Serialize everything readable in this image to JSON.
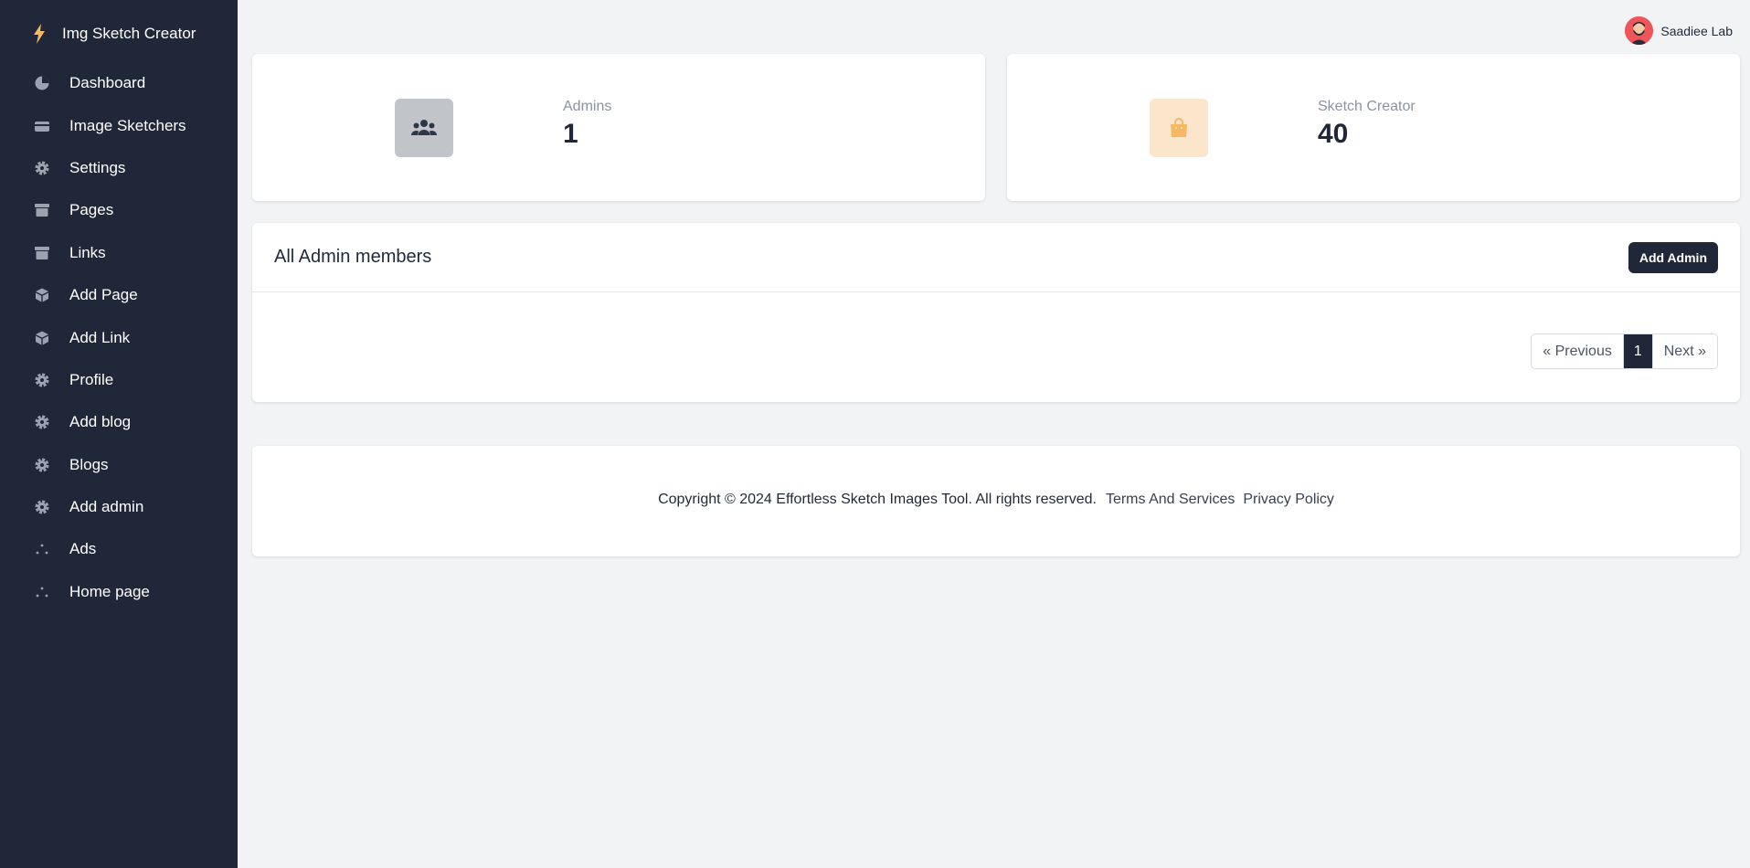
{
  "sidebar": {
    "brand": "Img Sketch Creator",
    "brand_icon": "bolt-icon",
    "items": [
      {
        "label": "Dashboard",
        "icon": "pie-chart-icon"
      },
      {
        "label": "Image Sketchers",
        "icon": "credit-card-icon"
      },
      {
        "label": "Settings",
        "icon": "gear-icon"
      },
      {
        "label": "Pages",
        "icon": "archive-icon"
      },
      {
        "label": "Links",
        "icon": "archive-icon"
      },
      {
        "label": "Add Page",
        "icon": "cube-icon"
      },
      {
        "label": "Add Link",
        "icon": "cube-icon"
      },
      {
        "label": "Profile",
        "icon": "gear-icon"
      },
      {
        "label": "Add blog",
        "icon": "gear-icon"
      },
      {
        "label": "Blogs",
        "icon": "gear-icon"
      },
      {
        "label": "Add admin",
        "icon": "gear-icon"
      },
      {
        "label": "Ads",
        "icon": "dots-icon"
      },
      {
        "label": "Home page",
        "icon": "dots-icon"
      }
    ]
  },
  "header": {
    "user_name": "Saadiee Lab"
  },
  "stats": [
    {
      "label": "Admins",
      "value": "1",
      "icon": "users-icon"
    },
    {
      "label": "Sketch Creator",
      "value": "40",
      "icon": "shopping-bag-icon"
    }
  ],
  "admins": {
    "title": "All Admin members",
    "add_label": "Add Admin",
    "pagination": {
      "previous": "« Previous",
      "current": "1",
      "next": "Next »"
    }
  },
  "footer": {
    "copyright": "Copyright © 2024 Effortless Sketch Images Tool. All rights reserved.",
    "terms": "Terms And Services",
    "privacy": "Privacy Policy"
  },
  "colors": {
    "sidebar_bg": "#1f2738",
    "page_bg": "#f2f3f5",
    "accent_dark": "#1f2738",
    "admins_icon_bg": "#c1c5ca",
    "sketch_icon_bg": "#fbe5cb",
    "sketch_icon": "#f6b862",
    "brand_bolt": "#f6b862"
  }
}
